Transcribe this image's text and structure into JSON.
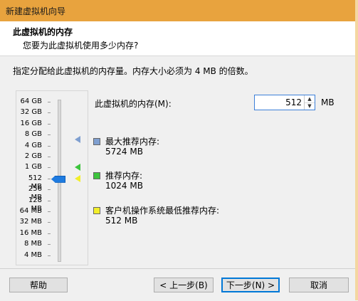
{
  "window": {
    "title": "新建虚拟机向导"
  },
  "header": {
    "title": "此虚拟机的内存",
    "subtitle": "您要为此虚拟机使用多少内存?"
  },
  "instruction": "指定分配给此虚拟机的内存量。内存大小必须为 4 MB 的倍数。",
  "slider": {
    "ticks": [
      "64 GB",
      "32 GB",
      "16 GB",
      "8 GB",
      "4 GB",
      "2 GB",
      "1 GB",
      "512 MB",
      "256 MB",
      "128 MB",
      "64 MB",
      "32 MB",
      "16 MB",
      "8 MB",
      "4 MB"
    ],
    "selected": "512 MB",
    "thumb_color": "#1e7be0"
  },
  "memory": {
    "label": "此虚拟机的内存(M):",
    "value": "512",
    "unit": "MB"
  },
  "legend": {
    "max": {
      "title": "最大推荐内存:",
      "value": "5724 MB",
      "color": "#7f9fd0"
    },
    "recommended": {
      "title": "推荐内存:",
      "value": "1024 MB",
      "color": "#3cc43c"
    },
    "guest_min": {
      "title": "客户机操作系统最低推荐内存:",
      "value": "512 MB",
      "color": "#f2ee2a"
    }
  },
  "buttons": {
    "help": "帮助",
    "back": "< 上一步(B)",
    "next": "下一步(N) >",
    "cancel": "取消"
  }
}
